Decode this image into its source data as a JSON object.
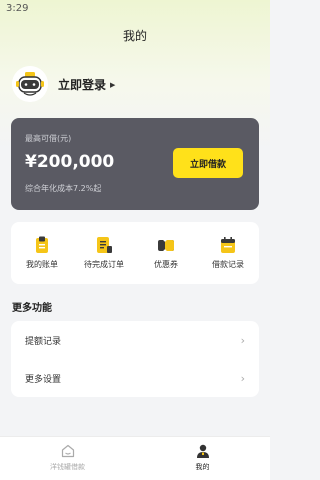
{
  "status_bar": {
    "time": "3:29"
  },
  "header": {
    "title": "我的"
  },
  "profile": {
    "login_text": "立即登录"
  },
  "credit": {
    "label": "最高可借(元)",
    "amount": "¥200,000",
    "rate_note": "综合年化成本7.2%起",
    "borrow_button": "立即借款"
  },
  "quick_actions": [
    {
      "label": "我的账单",
      "icon": "bill-icon"
    },
    {
      "label": "待完成订单",
      "icon": "order-icon"
    },
    {
      "label": "优惠券",
      "icon": "coupon-icon"
    },
    {
      "label": "借款记录",
      "icon": "loan-record-icon"
    }
  ],
  "more": {
    "title": "更多功能",
    "items": [
      {
        "label": "提额记录"
      },
      {
        "label": "更多设置"
      }
    ]
  },
  "tabbar": {
    "items": [
      {
        "label": "洋钱罐借款",
        "icon": "home-icon",
        "active": false
      },
      {
        "label": "我的",
        "icon": "user-icon",
        "active": true
      }
    ]
  },
  "colors": {
    "accent": "#ffe11a",
    "card": "#5a5a63",
    "icon_yellow": "#f5c518"
  }
}
